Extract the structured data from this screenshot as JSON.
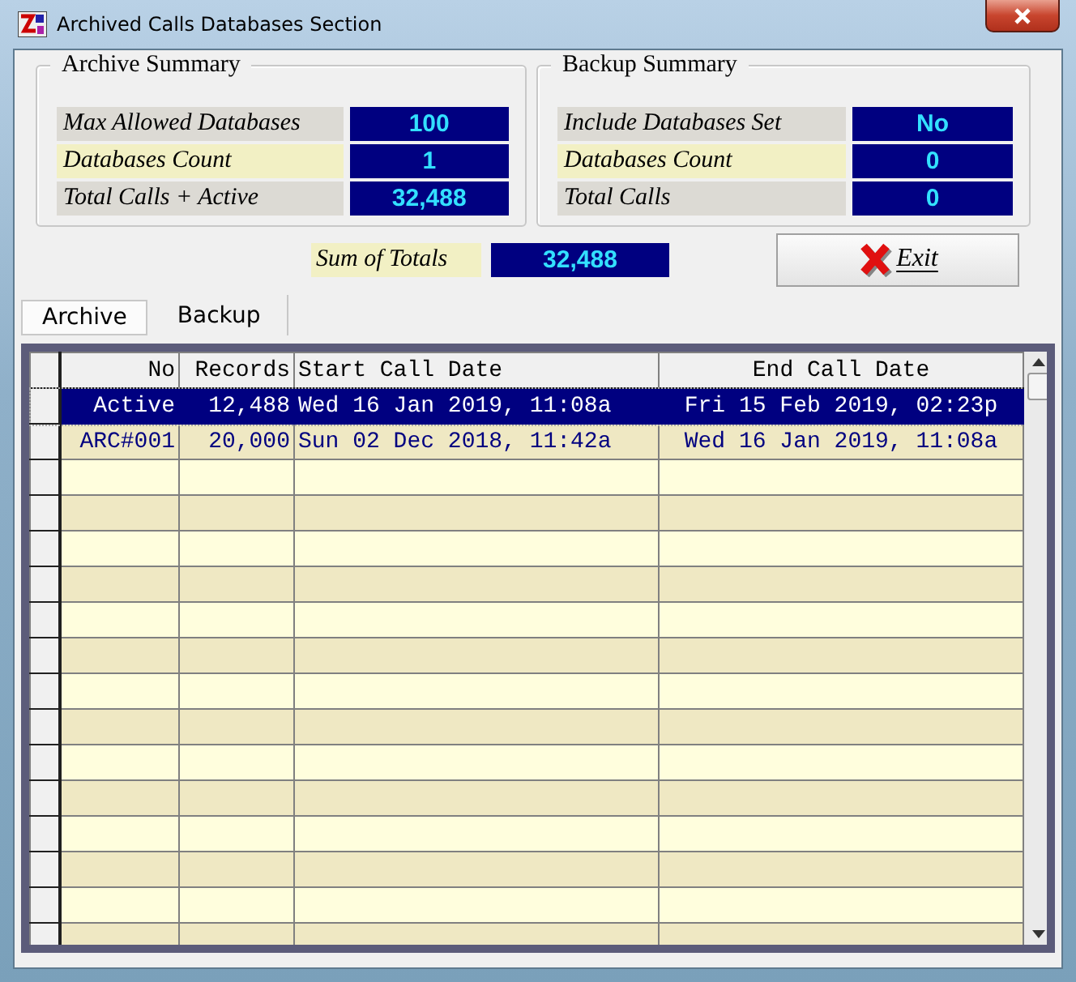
{
  "window": {
    "title": "Archived Calls Databases Section"
  },
  "archive_summary": {
    "title": "Archive Summary",
    "rows": [
      {
        "label": "Max Allowed Databases",
        "value": "100",
        "highlight": false
      },
      {
        "label": "Databases Count",
        "value": "1",
        "highlight": true
      },
      {
        "label": "Total Calls + Active",
        "value": "32,488",
        "highlight": false
      }
    ]
  },
  "backup_summary": {
    "title": "Backup Summary",
    "rows": [
      {
        "label": "Include Databases Set",
        "value": "No",
        "highlight": false
      },
      {
        "label": "Databases Count",
        "value": "0",
        "highlight": true
      },
      {
        "label": "Total Calls",
        "value": "0",
        "highlight": false
      }
    ]
  },
  "sum_of_totals": {
    "label": "Sum of Totals",
    "value": "32,488"
  },
  "exit_button": {
    "label": "Exit"
  },
  "tabs": [
    {
      "label": "Archive",
      "selected": true
    },
    {
      "label": "Backup",
      "selected": false
    }
  ],
  "table": {
    "columns": [
      "No",
      "Records",
      "Start Call Date",
      "End Call Date"
    ],
    "rows": [
      {
        "cells": [
          "Active",
          "12,488",
          "Wed 16 Jan 2019, 11:08a",
          "Fri 15 Feb 2019, 02:23p"
        ],
        "selected": true
      },
      {
        "cells": [
          "ARC#001",
          "20,000",
          "Sun 02 Dec 2018, 11:42a",
          "Wed 16 Jan 2019, 11:08a"
        ],
        "selected": false
      }
    ]
  }
}
